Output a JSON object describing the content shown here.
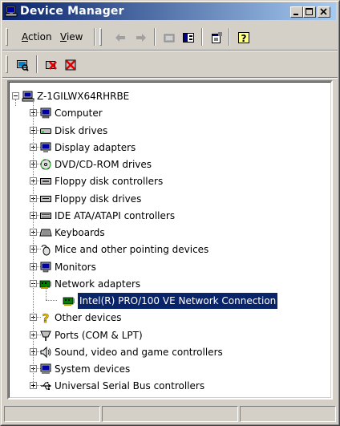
{
  "window": {
    "title": "Device Manager",
    "buttons": [
      "minimize",
      "maximize",
      "close"
    ]
  },
  "menu": {
    "action_label": "Action",
    "action_access": "A",
    "view_label": "View",
    "view_access": "V"
  },
  "toolbar": {
    "icons": [
      "back-icon",
      "forward-icon",
      "up-level-icon",
      "show-hide-tree-icon",
      "properties-icon",
      "help-icon"
    ]
  },
  "toolbar2": {
    "icons": [
      "scan-hardware-icon",
      "uninstall-icon",
      "disable-device-icon"
    ]
  },
  "tree": {
    "root": "Z-1GILWX64RHRBE",
    "nodes": [
      {
        "label": "Computer",
        "expanded": false,
        "icon": "computer-icon"
      },
      {
        "label": "Disk drives",
        "expanded": false,
        "icon": "disk-drive-icon"
      },
      {
        "label": "Display adapters",
        "expanded": false,
        "icon": "display-adapter-icon"
      },
      {
        "label": "DVD/CD-ROM drives",
        "expanded": false,
        "icon": "dvd-drive-icon"
      },
      {
        "label": "Floppy disk controllers",
        "expanded": false,
        "icon": "floppy-controller-icon"
      },
      {
        "label": "Floppy disk drives",
        "expanded": false,
        "icon": "floppy-drive-icon"
      },
      {
        "label": "IDE ATA/ATAPI controllers",
        "expanded": false,
        "icon": "ide-controller-icon"
      },
      {
        "label": "Keyboards",
        "expanded": false,
        "icon": "keyboard-icon"
      },
      {
        "label": "Mice and other pointing devices",
        "expanded": false,
        "icon": "mouse-icon"
      },
      {
        "label": "Monitors",
        "expanded": false,
        "icon": "monitor-icon"
      },
      {
        "label": "Network adapters",
        "expanded": true,
        "icon": "network-adapter-icon",
        "children": [
          {
            "label": "Intel(R) PRO/100 VE Network Connection",
            "selected": true,
            "icon": "network-card-icon"
          }
        ]
      },
      {
        "label": "Other devices",
        "expanded": false,
        "icon": "question-mark-icon"
      },
      {
        "label": "Ports (COM & LPT)",
        "expanded": false,
        "icon": "port-icon"
      },
      {
        "label": "Sound, video and game controllers",
        "expanded": false,
        "icon": "sound-icon"
      },
      {
        "label": "System devices",
        "expanded": false,
        "icon": "system-device-icon"
      },
      {
        "label": "Universal Serial Bus controllers",
        "expanded": false,
        "icon": "usb-icon"
      }
    ]
  },
  "colors": {
    "title_active": "#0a246a",
    "title_gradient_end": "#a6caf0",
    "face": "#d4d0c8",
    "selection": "#0a246a"
  }
}
